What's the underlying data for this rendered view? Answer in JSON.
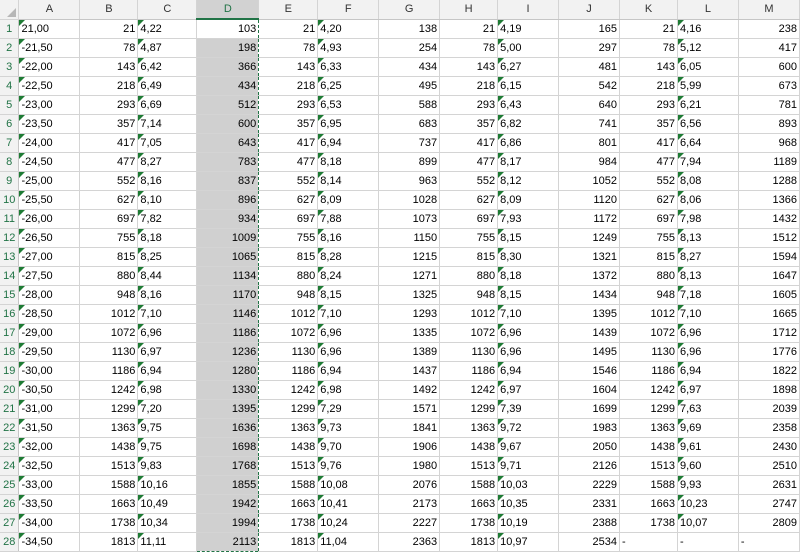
{
  "sheet": {
    "columns": [
      "A",
      "B",
      "C",
      "D",
      "E",
      "F",
      "G",
      "H",
      "I",
      "J",
      "K",
      "L",
      "M"
    ],
    "selected_column": "D",
    "rows": [
      [
        "21,00",
        "21",
        "4,22",
        "103",
        "21",
        "4,20",
        "138",
        "21",
        "4,19",
        "165",
        "21",
        "4,16",
        "238"
      ],
      [
        "-21,50",
        "78",
        "4,87",
        "198",
        "78",
        "4,93",
        "254",
        "78",
        "5,00",
        "297",
        "78",
        "5,12",
        "417"
      ],
      [
        "-22,00",
        "143",
        "6,42",
        "366",
        "143",
        "6,33",
        "434",
        "143",
        "6,27",
        "481",
        "143",
        "6,05",
        "600"
      ],
      [
        "-22,50",
        "218",
        "6,49",
        "434",
        "218",
        "6,25",
        "495",
        "218",
        "6,15",
        "542",
        "218",
        "5,99",
        "673"
      ],
      [
        "-23,00",
        "293",
        "6,69",
        "512",
        "293",
        "6,53",
        "588",
        "293",
        "6,43",
        "640",
        "293",
        "6,21",
        "781"
      ],
      [
        "-23,50",
        "357",
        "7,14",
        "600",
        "357",
        "6,95",
        "683",
        "357",
        "6,82",
        "741",
        "357",
        "6,56",
        "893"
      ],
      [
        "-24,00",
        "417",
        "7,05",
        "643",
        "417",
        "6,94",
        "737",
        "417",
        "6,86",
        "801",
        "417",
        "6,64",
        "968"
      ],
      [
        "-24,50",
        "477",
        "8,27",
        "783",
        "477",
        "8,18",
        "899",
        "477",
        "8,17",
        "984",
        "477",
        "7,94",
        "1189"
      ],
      [
        "-25,00",
        "552",
        "8,16",
        "837",
        "552",
        "8,14",
        "963",
        "552",
        "8,12",
        "1052",
        "552",
        "8,08",
        "1288"
      ],
      [
        "-25,50",
        "627",
        "8,10",
        "896",
        "627",
        "8,09",
        "1028",
        "627",
        "8,09",
        "1120",
        "627",
        "8,06",
        "1366"
      ],
      [
        "-26,00",
        "697",
        "7,82",
        "934",
        "697",
        "7,88",
        "1073",
        "697",
        "7,93",
        "1172",
        "697",
        "7,98",
        "1432"
      ],
      [
        "-26,50",
        "755",
        "8,18",
        "1009",
        "755",
        "8,16",
        "1150",
        "755",
        "8,15",
        "1249",
        "755",
        "8,13",
        "1512"
      ],
      [
        "-27,00",
        "815",
        "8,25",
        "1065",
        "815",
        "8,28",
        "1215",
        "815",
        "8,30",
        "1321",
        "815",
        "8,27",
        "1594"
      ],
      [
        "-27,50",
        "880",
        "8,44",
        "1134",
        "880",
        "8,24",
        "1271",
        "880",
        "8,18",
        "1372",
        "880",
        "8,13",
        "1647"
      ],
      [
        "-28,00",
        "948",
        "8,16",
        "1170",
        "948",
        "8,15",
        "1325",
        "948",
        "8,15",
        "1434",
        "948",
        "7,18",
        "1605"
      ],
      [
        "-28,50",
        "1012",
        "7,10",
        "1146",
        "1012",
        "7,10",
        "1293",
        "1012",
        "7,10",
        "1395",
        "1012",
        "7,10",
        "1665"
      ],
      [
        "-29,00",
        "1072",
        "6,96",
        "1186",
        "1072",
        "6,96",
        "1335",
        "1072",
        "6,96",
        "1439",
        "1072",
        "6,96",
        "1712"
      ],
      [
        "-29,50",
        "1130",
        "6,97",
        "1236",
        "1130",
        "6,96",
        "1389",
        "1130",
        "6,96",
        "1495",
        "1130",
        "6,96",
        "1776"
      ],
      [
        "-30,00",
        "1186",
        "6,94",
        "1280",
        "1186",
        "6,94",
        "1437",
        "1186",
        "6,94",
        "1546",
        "1186",
        "6,94",
        "1822"
      ],
      [
        "-30,50",
        "1242",
        "6,98",
        "1330",
        "1242",
        "6,98",
        "1492",
        "1242",
        "6,97",
        "1604",
        "1242",
        "6,97",
        "1898"
      ],
      [
        "-31,00",
        "1299",
        "7,20",
        "1395",
        "1299",
        "7,29",
        "1571",
        "1299",
        "7,39",
        "1699",
        "1299",
        "7,63",
        "2039"
      ],
      [
        "-31,50",
        "1363",
        "9,75",
        "1636",
        "1363",
        "9,73",
        "1841",
        "1363",
        "9,72",
        "1983",
        "1363",
        "9,69",
        "2358"
      ],
      [
        "-32,00",
        "1438",
        "9,75",
        "1698",
        "1438",
        "9,70",
        "1906",
        "1438",
        "9,67",
        "2050",
        "1438",
        "9,61",
        "2430"
      ],
      [
        "-32,50",
        "1513",
        "9,83",
        "1768",
        "1513",
        "9,76",
        "1980",
        "1513",
        "9,71",
        "2126",
        "1513",
        "9,60",
        "2510"
      ],
      [
        "-33,00",
        "1588",
        "10,16",
        "1855",
        "1588",
        "10,08",
        "2076",
        "1588",
        "10,03",
        "2229",
        "1588",
        "9,93",
        "2631"
      ],
      [
        "-33,50",
        "1663",
        "10,49",
        "1942",
        "1663",
        "10,41",
        "2173",
        "1663",
        "10,35",
        "2331",
        "1663",
        "10,23",
        "2747"
      ],
      [
        "-34,00",
        "1738",
        "10,34",
        "1994",
        "1738",
        "10,24",
        "2227",
        "1738",
        "10,19",
        "2388",
        "1738",
        "10,07",
        "2809"
      ],
      [
        "-34,50",
        "1813",
        "11,11",
        "2113",
        "1813",
        "11,04",
        "2363",
        "1813",
        "10,97",
        "2534",
        "-",
        "-",
        "-"
      ]
    ]
  }
}
